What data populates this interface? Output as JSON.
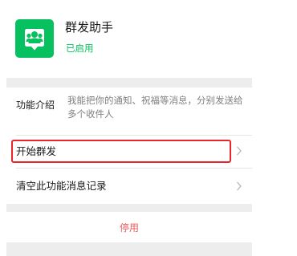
{
  "app": {
    "name": "群发助手",
    "status": "已启用",
    "icon": "group-send-assistant-icon"
  },
  "intro": {
    "label": "功能介绍",
    "text": "我能把你的通知、祝福等消息，分别发送给多个收件人"
  },
  "rows": [
    {
      "label": "开始群发",
      "icon": "chevron-right-icon",
      "highlighted": true
    },
    {
      "label": "清空此功能消息记录",
      "icon": "chevron-right-icon",
      "highlighted": false
    }
  ],
  "disable_label": "停用",
  "colors": {
    "accent": "#07c160",
    "danger": "#e45b5b",
    "highlight": "#e8262b",
    "background": "#ededed"
  }
}
